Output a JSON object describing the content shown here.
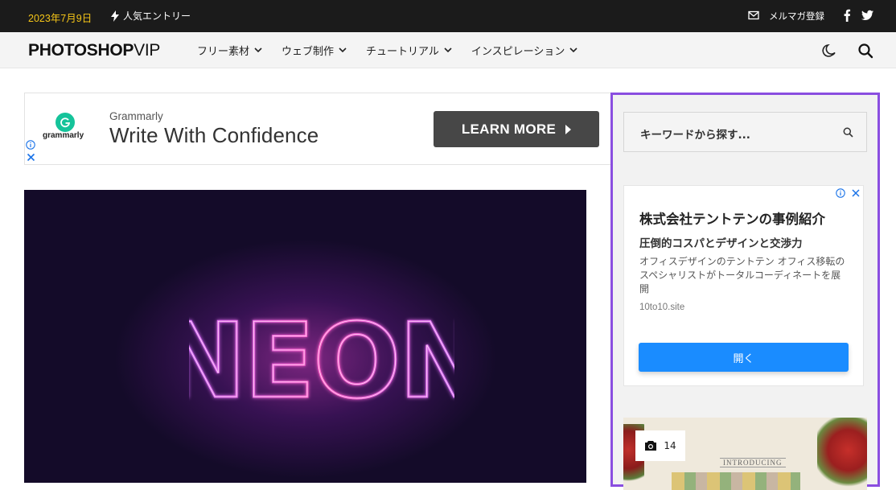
{
  "topbar": {
    "date": "2023年7月9日",
    "popular_label": "人気エントリー",
    "newsletter_label": "メルマガ登録",
    "icons": [
      "bolt-icon",
      "mail-icon",
      "facebook-icon",
      "twitter-icon"
    ]
  },
  "header": {
    "logo_main": "PHOTOSHOP",
    "logo_vip": "VIP",
    "nav": [
      {
        "label": "フリー素材"
      },
      {
        "label": "ウェブ制作"
      },
      {
        "label": "チュートリアル"
      },
      {
        "label": "インスピレーション"
      }
    ],
    "icons": [
      "moon-icon",
      "search-icon"
    ]
  },
  "ad_banner": {
    "logo_word": "grammarly",
    "brand": "Grammarly",
    "headline": "Write With Confidence",
    "cta": "LEARN MORE"
  },
  "hero": {
    "neon_text": "NEON"
  },
  "sidebar": {
    "search_placeholder": "キーワードから探す...",
    "ad": {
      "title": "株式会社テントテンの事例紹介",
      "subtitle": "圧倒的コスパとデザインと交渉力",
      "body": "オフィスデザインのテントテン オフィス移転のスペシャリストがトータルコーディネートを展開",
      "domain": "10to10.site",
      "button": "開く"
    },
    "card": {
      "photo_count": "14",
      "intro_text": "INTRODUCING"
    }
  },
  "colors": {
    "topbar_bg": "#1b1b1b",
    "date_color": "#f5c518",
    "sidebar_border": "#8a4ee0",
    "open_button": "#1a8cff",
    "grammarly_green": "#15c39a"
  }
}
